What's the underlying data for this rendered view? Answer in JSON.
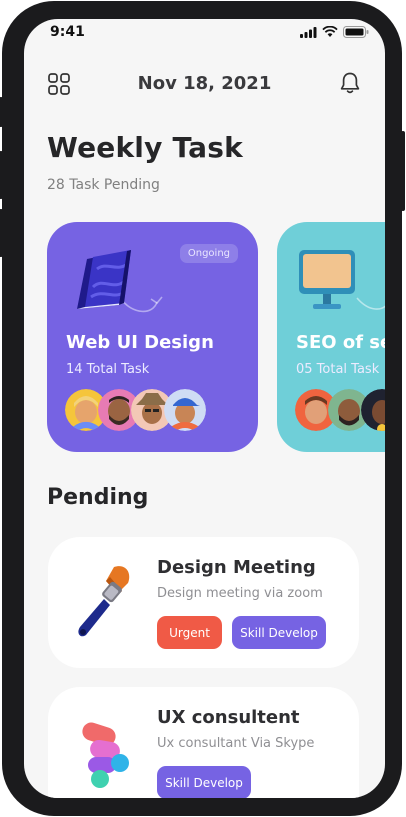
{
  "status_bar": {
    "time": "9:41"
  },
  "header": {
    "date": "Nov 18, 2021",
    "menu_icon": "grid-icon",
    "notification_icon": "bell-icon"
  },
  "page": {
    "title": "Weekly Task",
    "subtitle": "28 Task Pending"
  },
  "cards": [
    {
      "badge": "Ongoing",
      "title": "Web UI Design",
      "count": "14 Total Task",
      "color": "#7663e3",
      "icon": "book-icon"
    },
    {
      "title": "SEO of ser",
      "count": "05 Total Task",
      "color": "#6fcfd8",
      "icon": "monitor-icon"
    }
  ],
  "pending": {
    "heading": "Pending",
    "items": [
      {
        "title": "Design Meeting",
        "desc": "Design meeting via zoom",
        "tags": [
          "Urgent",
          "Skill Develop"
        ],
        "icon": "paint-brush-icon"
      },
      {
        "title": "UX consultent",
        "desc": "Ux consultant Via Skype",
        "tags": [
          "Skill Develop"
        ],
        "icon": "figma-icon"
      }
    ]
  },
  "colors": {
    "accent": "#7663e3",
    "urgent": "#f05a46",
    "teal": "#6fcfd8",
    "background": "#f6f6f6"
  }
}
